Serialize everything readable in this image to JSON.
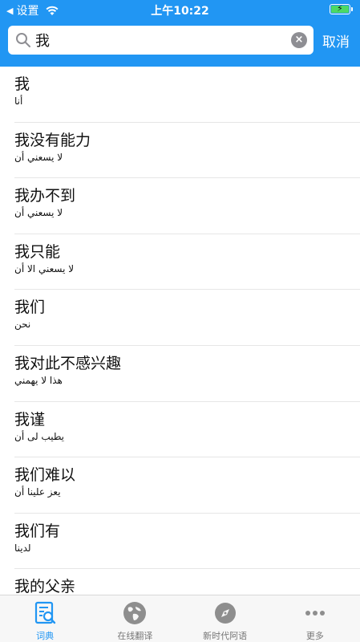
{
  "status": {
    "back_label": "设置",
    "time": "上午10:22"
  },
  "search": {
    "value": "我",
    "cancel_label": "取消"
  },
  "results": [
    {
      "zh": "我",
      "ar": "أنا"
    },
    {
      "zh": "我没有能力",
      "ar": "لا يسعني أن"
    },
    {
      "zh": "我办不到",
      "ar": "لا يسعني أن"
    },
    {
      "zh": "我只能",
      "ar": "لا يسعني الا أن"
    },
    {
      "zh": "我们",
      "ar": "نحن"
    },
    {
      "zh": "我对此不感兴趣",
      "ar": "هذا لا يهمني"
    },
    {
      "zh": "我谨",
      "ar": "يطيب لى أن"
    },
    {
      "zh": "我们难以",
      "ar": "يعز علينا أن"
    },
    {
      "zh": "我们有",
      "ar": "لدينا"
    },
    {
      "zh": "我的父亲",
      "ar": ""
    }
  ],
  "tabs": [
    {
      "label": "词典",
      "icon": "dictionary-icon",
      "active": true
    },
    {
      "label": "在线翻译",
      "icon": "globe-icon",
      "active": false
    },
    {
      "label": "新时代阿语",
      "icon": "compass-icon",
      "active": false
    },
    {
      "label": "更多",
      "icon": "more-icon",
      "active": false
    }
  ],
  "colors": {
    "accent": "#2196f3",
    "battery": "#4cd964"
  }
}
